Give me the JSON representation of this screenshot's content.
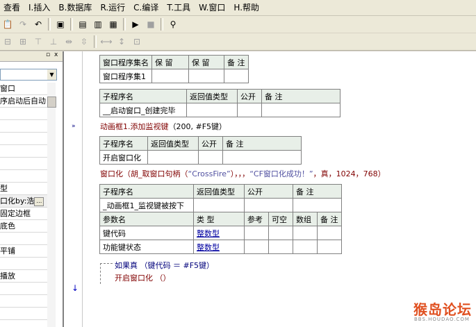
{
  "menus": [
    "查看",
    "I.插入",
    "B.数据库",
    "R.运行",
    "C.编译",
    "T.工具",
    "W.窗口",
    "H.帮助"
  ],
  "left_panel": {
    "close": "x",
    "rows": [
      "窗口",
      "序启动后自动",
      "",
      "",
      "",
      "",
      "",
      "",
      "型",
      "口化by:浩",
      "固定边框",
      "底色",
      "",
      "平铺",
      "",
      "播放",
      "",
      "",
      ""
    ]
  },
  "tables": {
    "program_set": {
      "headers": [
        "窗口程序集名",
        "保 留",
        "保 留",
        "备 注"
      ],
      "name": "窗口程序集1"
    },
    "sub1": {
      "headers": [
        "子程序名",
        "返回值类型",
        "公开",
        "备 注"
      ],
      "name": "__启动窗口_创建完毕"
    },
    "sub2": {
      "headers": [
        "子程序名",
        "返回值类型",
        "公开",
        "备 注"
      ],
      "name": "开启窗口化"
    },
    "sub3": {
      "headers": [
        "子程序名",
        "返回值类型",
        "公开",
        "备 注"
      ],
      "name": "_动画框1_监视键被按下",
      "param_headers": [
        "参数名",
        "类 型",
        "参考",
        "可空",
        "数组",
        "备 注"
      ],
      "params": [
        {
          "name": "键代码",
          "type": "整数型"
        },
        {
          "name": "功能键状态",
          "type": "整数型"
        }
      ]
    }
  },
  "code": {
    "line1_fn": "动画框1.添加监视键",
    "line1_args": "（200, #F5键）",
    "line2_fn": "窗口化",
    "line2_mid": "（胡_取窗口句柄（",
    "line2_str1": "“CrossFire”",
    "line2_mid2": "），，，",
    "line2_str2": "“CF窗口化成功！”",
    "line2_rest": "，真，1024，768）",
    "if_line": "如果真 （键代码 ＝ #F5键）",
    "call_line": "开启窗口化 （）"
  },
  "watermark": {
    "title": "猴岛论坛",
    "sub": "BBS.HOUDAO.COM"
  }
}
